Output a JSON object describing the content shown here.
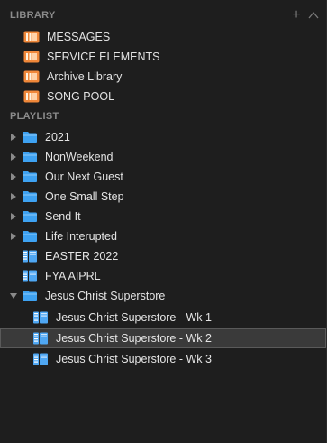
{
  "library": {
    "header": "LIBRARY",
    "items": [
      {
        "label": "MESSAGES"
      },
      {
        "label": "SERVICE ELEMENTS"
      },
      {
        "label": "Archive Library"
      },
      {
        "label": "SONG POOL"
      }
    ]
  },
  "playlist": {
    "header": "PLAYLIST",
    "items": [
      {
        "label": "2021",
        "kind": "folder",
        "expanded": false
      },
      {
        "label": "NonWeekend",
        "kind": "folder",
        "expanded": false
      },
      {
        "label": "Our Next Guest",
        "kind": "folder",
        "expanded": false
      },
      {
        "label": "One Small Step",
        "kind": "folder",
        "expanded": false
      },
      {
        "label": "Send It",
        "kind": "folder",
        "expanded": false
      },
      {
        "label": "Life Interupted",
        "kind": "folder",
        "expanded": false
      },
      {
        "label": "EASTER 2022",
        "kind": "playlist"
      },
      {
        "label": "FYA AIPRL",
        "kind": "playlist"
      },
      {
        "label": "Jesus Christ Superstore",
        "kind": "folder",
        "expanded": true
      },
      {
        "label": "Jesus Christ Superstore - Wk 1",
        "kind": "playlist",
        "child": true
      },
      {
        "label": "Jesus Christ Superstore - Wk 2",
        "kind": "playlist",
        "child": true,
        "selected": true
      },
      {
        "label": "Jesus Christ Superstore - Wk 3",
        "kind": "playlist",
        "child": true
      }
    ]
  },
  "colors": {
    "library_icon": "#f0883a",
    "folder_icon": "#3ea2f2",
    "playlist_icon": "#4fa7f3"
  }
}
